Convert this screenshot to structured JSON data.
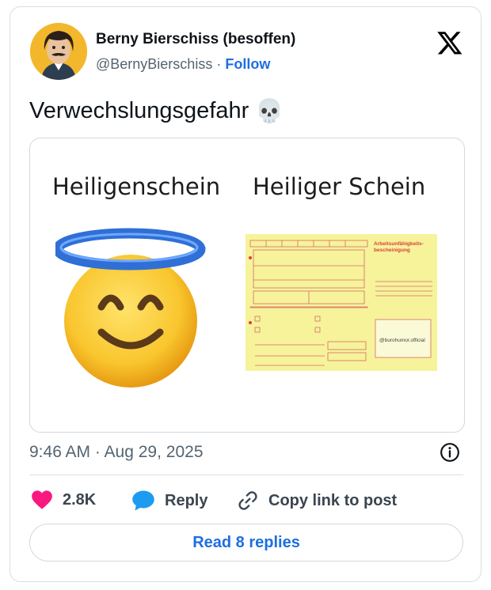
{
  "author": {
    "display_name": "Berny Bierschiss (besoffen)",
    "handle": "@BernyBierschiss",
    "separator": "·",
    "follow_label": "Follow"
  },
  "tweet": {
    "text": "Verwechslungsgefahr",
    "emoji": "💀"
  },
  "media": {
    "left_caption": "Heiligenschein",
    "right_caption": "Heiliger Schein",
    "form_title_line1": "Arbeitsunfähigkeits-",
    "form_title_line2": "bescheinigung",
    "form_watermark": "@burohumor.official"
  },
  "meta": {
    "timestamp": "9:46 AM · Aug 29, 2025"
  },
  "actions": {
    "likes_count": "2.8K",
    "reply_label": "Reply",
    "copy_label": "Copy link to post",
    "read_replies_label": "Read 8 replies"
  },
  "colors": {
    "follow": "#1d6fe0",
    "like": "#f91880",
    "reply_bubble": "#1d9bf0",
    "form_bg": "#f6f39a",
    "form_lines": "#d86a6a"
  }
}
